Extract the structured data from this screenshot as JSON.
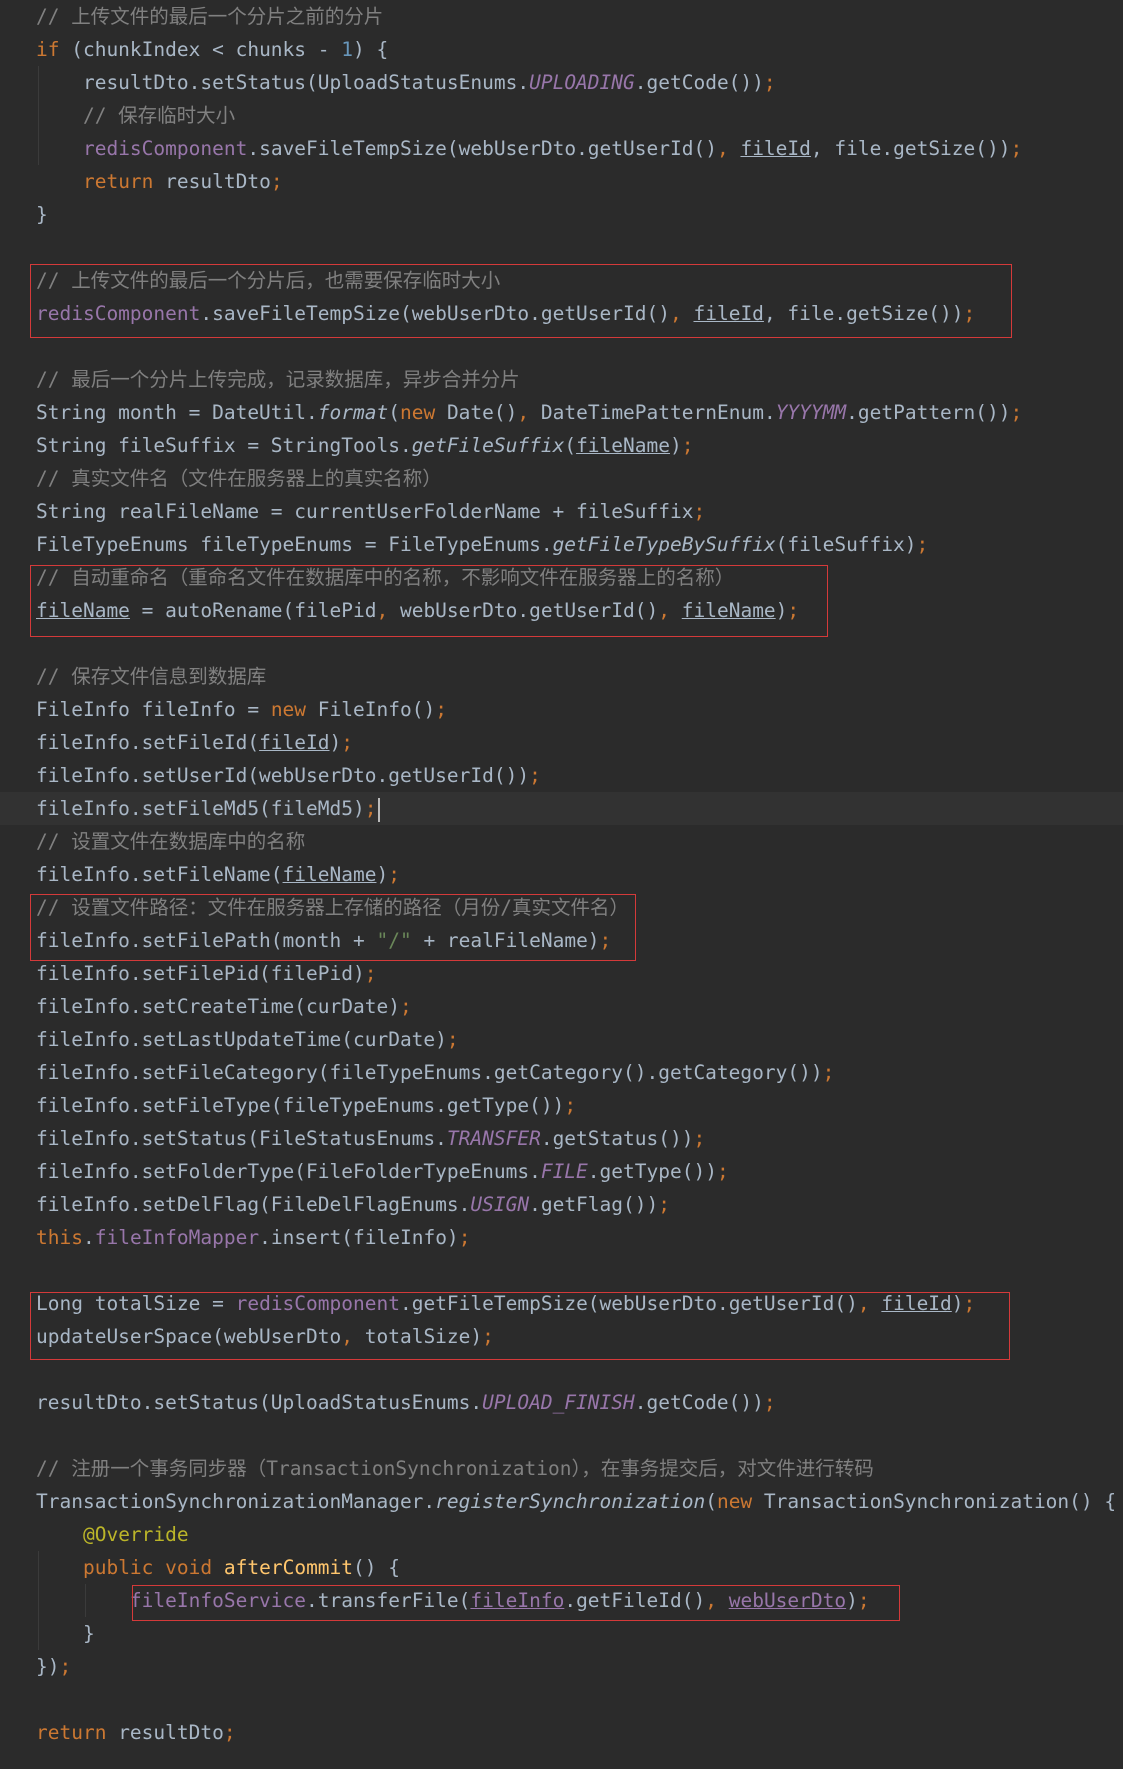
{
  "editor": {
    "lines": [
      [
        {
          "t": "// 上传文件的最后一个分片之前的分片",
          "c": "cm"
        }
      ],
      [
        {
          "t": "if",
          "c": "kw"
        },
        {
          "t": " (chunkIndex < chunks - "
        },
        {
          "t": "1",
          "c": "num"
        },
        {
          "t": ") {"
        }
      ],
      [
        {
          "t": "    resultDto.setStatus(UploadStatusEnums."
        },
        {
          "t": "UPLOADING",
          "c": "cst"
        },
        {
          "t": ".getCode())"
        },
        {
          "t": ";",
          "c": "kw"
        }
      ],
      [
        {
          "t": "    // 保存临时大小",
          "c": "cm"
        }
      ],
      [
        {
          "t": "    "
        },
        {
          "t": "redisComponent",
          "c": "fld"
        },
        {
          "t": ".saveFileTempSize(webUserDto.getUserId()"
        },
        {
          "t": ",",
          "c": "kw"
        },
        {
          "t": " "
        },
        {
          "t": "fileId",
          "c": "ul"
        },
        {
          "t": ","
        },
        {
          "t": " file.getSize())"
        },
        {
          "t": ";",
          "c": "kw"
        }
      ],
      [
        {
          "t": "    "
        },
        {
          "t": "return",
          "c": "kw"
        },
        {
          "t": " resultDto"
        },
        {
          "t": ";",
          "c": "kw"
        }
      ],
      [
        {
          "t": "}"
        }
      ],
      [],
      [
        {
          "t": "// 上传文件的最后一个分片后，也需要保存临时大小",
          "c": "cm"
        }
      ],
      [
        {
          "t": "redisComponent",
          "c": "fld"
        },
        {
          "t": ".saveFileTempSize(webUserDto.getUserId()"
        },
        {
          "t": ",",
          "c": "kw"
        },
        {
          "t": " "
        },
        {
          "t": "fileId",
          "c": "ul"
        },
        {
          "t": ","
        },
        {
          "t": " file.getSize())"
        },
        {
          "t": ";",
          "c": "kw"
        }
      ],
      [],
      [
        {
          "t": "// 最后一个分片上传完成，记录数据库，异步合并分片",
          "c": "cm"
        }
      ],
      [
        {
          "t": "String month = DateUtil."
        },
        {
          "t": "format",
          "c": "sm"
        },
        {
          "t": "("
        },
        {
          "t": "new",
          "c": "kw"
        },
        {
          "t": " Date()"
        },
        {
          "t": ",",
          "c": "kw"
        },
        {
          "t": " DateTimePatternEnum."
        },
        {
          "t": "YYYYMM",
          "c": "cst"
        },
        {
          "t": ".getPattern())"
        },
        {
          "t": ";",
          "c": "kw"
        }
      ],
      [
        {
          "t": "String fileSuffix = StringTools."
        },
        {
          "t": "getFileSuffix",
          "c": "sm"
        },
        {
          "t": "("
        },
        {
          "t": "fileName",
          "c": "ul"
        },
        {
          "t": ")"
        },
        {
          "t": ";",
          "c": "kw"
        }
      ],
      [
        {
          "t": "// 真实文件名（文件在服务器上的真实名称）",
          "c": "cm"
        }
      ],
      [
        {
          "t": "String realFileName = currentUserFolderName + fileSuffix"
        },
        {
          "t": ";",
          "c": "kw"
        }
      ],
      [
        {
          "t": "FileTypeEnums fileTypeEnums = FileTypeEnums."
        },
        {
          "t": "getFileTypeBySuffix",
          "c": "sm"
        },
        {
          "t": "(fileSuffix)"
        },
        {
          "t": ";",
          "c": "kw"
        }
      ],
      [
        {
          "t": "// 自动重命名（重命名文件在数据库中的名称，不影响文件在服务器上的名称）",
          "c": "cm"
        }
      ],
      [
        {
          "t": "fileName",
          "c": "ul"
        },
        {
          "t": " = autoRename(filePid"
        },
        {
          "t": ",",
          "c": "kw"
        },
        {
          "t": " webUserDto.getUserId()"
        },
        {
          "t": ",",
          "c": "kw"
        },
        {
          "t": " "
        },
        {
          "t": "fileName",
          "c": "ul"
        },
        {
          "t": ")"
        },
        {
          "t": ";",
          "c": "kw"
        }
      ],
      [],
      [
        {
          "t": "// 保存文件信息到数据库",
          "c": "cm"
        }
      ],
      [
        {
          "t": "FileInfo fileInfo = "
        },
        {
          "t": "new",
          "c": "kw"
        },
        {
          "t": " FileInfo()"
        },
        {
          "t": ";",
          "c": "kw"
        }
      ],
      [
        {
          "t": "fileInfo.setFileId("
        },
        {
          "t": "fileId",
          "c": "ul"
        },
        {
          "t": ")"
        },
        {
          "t": ";",
          "c": "kw"
        }
      ],
      [
        {
          "t": "fileInfo.setUserId(webUserDto.getUserId())"
        },
        {
          "t": ";",
          "c": "kw"
        }
      ],
      [
        {
          "t": "fileInfo.setFileMd5(fileMd5)"
        },
        {
          "t": ";",
          "c": "kw"
        }
      ],
      [
        {
          "t": "// 设置文件在数据库中的名称",
          "c": "cm"
        }
      ],
      [
        {
          "t": "fileInfo.setFileName("
        },
        {
          "t": "fileName",
          "c": "ul"
        },
        {
          "t": ")"
        },
        {
          "t": ";",
          "c": "kw"
        }
      ],
      [
        {
          "t": "// 设置文件路径：文件在服务器上存储的路径（月份/真实文件名）",
          "c": "cm"
        }
      ],
      [
        {
          "t": "fileInfo.setFilePath(month + "
        },
        {
          "t": "\"/\"",
          "c": "str"
        },
        {
          "t": " + realFileName)"
        },
        {
          "t": ";",
          "c": "kw"
        }
      ],
      [
        {
          "t": "fileInfo.setFilePid(filePid)"
        },
        {
          "t": ";",
          "c": "kw"
        }
      ],
      [
        {
          "t": "fileInfo.setCreateTime(curDate)"
        },
        {
          "t": ";",
          "c": "kw"
        }
      ],
      [
        {
          "t": "fileInfo.setLastUpdateTime(curDate)"
        },
        {
          "t": ";",
          "c": "kw"
        }
      ],
      [
        {
          "t": "fileInfo.setFileCategory(fileTypeEnums.getCategory().getCategory())"
        },
        {
          "t": ";",
          "c": "kw"
        }
      ],
      [
        {
          "t": "fileInfo.setFileType(fileTypeEnums.getType())"
        },
        {
          "t": ";",
          "c": "kw"
        }
      ],
      [
        {
          "t": "fileInfo.setStatus(FileStatusEnums."
        },
        {
          "t": "TRANSFER",
          "c": "cst"
        },
        {
          "t": ".getStatus())"
        },
        {
          "t": ";",
          "c": "kw"
        }
      ],
      [
        {
          "t": "fileInfo.setFolderType(FileFolderTypeEnums."
        },
        {
          "t": "FILE",
          "c": "cst"
        },
        {
          "t": ".getType())"
        },
        {
          "t": ";",
          "c": "kw"
        }
      ],
      [
        {
          "t": "fileInfo.setDelFlag(FileDelFlagEnums."
        },
        {
          "t": "USIGN",
          "c": "cst"
        },
        {
          "t": ".getFlag())"
        },
        {
          "t": ";",
          "c": "kw"
        }
      ],
      [
        {
          "t": "this",
          "c": "kw"
        },
        {
          "t": "."
        },
        {
          "t": "fileInfoMapper",
          "c": "fld"
        },
        {
          "t": ".insert(fileInfo)"
        },
        {
          "t": ";",
          "c": "kw"
        }
      ],
      [],
      [
        {
          "t": "Long totalSize = "
        },
        {
          "t": "redisComponent",
          "c": "fld"
        },
        {
          "t": ".getFileTempSize(webUserDto.getUserId()"
        },
        {
          "t": ",",
          "c": "kw"
        },
        {
          "t": " "
        },
        {
          "t": "fileId",
          "c": "ul"
        },
        {
          "t": ")"
        },
        {
          "t": ";",
          "c": "kw"
        }
      ],
      [
        {
          "t": "updateUserSpace(webUserDto"
        },
        {
          "t": ",",
          "c": "kw"
        },
        {
          "t": " totalSize)"
        },
        {
          "t": ";",
          "c": "kw"
        }
      ],
      [],
      [
        {
          "t": "resultDto.setStatus(UploadStatusEnums."
        },
        {
          "t": "UPLOAD_FINISH",
          "c": "cst"
        },
        {
          "t": ".getCode())"
        },
        {
          "t": ";",
          "c": "kw"
        }
      ],
      [],
      [
        {
          "t": "// 注册一个事务同步器（TransactionSynchronization），在事务提交后，对文件进行转码",
          "c": "cm"
        }
      ],
      [
        {
          "t": "TransactionSynchronizationManager."
        },
        {
          "t": "registerSynchronization",
          "c": "sm"
        },
        {
          "t": "("
        },
        {
          "t": "new",
          "c": "kw"
        },
        {
          "t": " TransactionSynchronization() {"
        }
      ],
      [
        {
          "t": "    "
        },
        {
          "t": "@Override",
          "c": "ann"
        }
      ],
      [
        {
          "t": "    "
        },
        {
          "t": "public",
          "c": "kw"
        },
        {
          "t": " "
        },
        {
          "t": "void",
          "c": "kw"
        },
        {
          "t": " "
        },
        {
          "t": "afterCommit",
          "c": "fn"
        },
        {
          "t": "() {"
        }
      ],
      [
        {
          "t": "        "
        },
        {
          "t": "fileInfoService",
          "c": "fld"
        },
        {
          "t": ".transferFile("
        },
        {
          "t": "fileInfo",
          "c": "fld ul"
        },
        {
          "t": ".getFileId()"
        },
        {
          "t": ",",
          "c": "kw"
        },
        {
          "t": " "
        },
        {
          "t": "webUserDto",
          "c": "fld ul"
        },
        {
          "t": ")"
        },
        {
          "t": ";",
          "c": "kw"
        }
      ],
      [
        {
          "t": "    }"
        }
      ],
      [
        {
          "t": "})"
        },
        {
          "t": ";",
          "c": "kw"
        }
      ],
      [],
      [
        {
          "t": "return",
          "c": "kw"
        },
        {
          "t": " resultDto"
        },
        {
          "t": ";",
          "c": "kw"
        }
      ]
    ],
    "current_line": 24
  },
  "colors": {
    "background": "#2b2b2b",
    "current_line": "#323232",
    "plain_text": "#a9b7c6",
    "comment": "#808080",
    "keyword": "#cc7832",
    "number": "#6897bb",
    "string": "#6a8759",
    "field_and_constant": "#9876aa",
    "annotation": "#bbb529",
    "method_declaration": "#ffc66d",
    "highlight_box": "#d43a3a"
  }
}
